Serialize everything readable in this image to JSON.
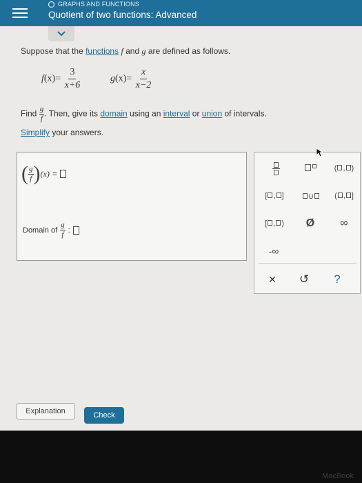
{
  "header": {
    "topic": "GRAPHS AND FUNCTIONS",
    "title": "Quotient of two functions: Advanced"
  },
  "prompt": {
    "intro_pre": "Suppose that the ",
    "intro_link": "functions",
    "intro_f": "f",
    "intro_and": " and ",
    "intro_g": "g",
    "intro_post": " are defined as follows.",
    "f_name": "f",
    "f_arg": "(x)=",
    "f_num": "3",
    "f_den": "x+6",
    "g_name": "g",
    "g_arg": "(x)=",
    "g_num": "x",
    "g_den": "x−2",
    "find_label": "Find",
    "find_num": "g",
    "find_den": "f",
    "find_then": ". Then, give its ",
    "domain_link": "domain",
    "using": " using an ",
    "interval_link": "interval",
    "or": " or ",
    "union_link": "union",
    "of_intervals": " of intervals.",
    "simplify_link": "Simplify",
    "simplify_rest": " your answers."
  },
  "answer": {
    "frac_num": "g",
    "frac_den": "f",
    "arg": "(x)",
    "equals": "=",
    "domain_label": "Domain of",
    "domain_num": "g",
    "domain_den": "f",
    "colon": ":"
  },
  "keypad": {
    "union": "∪",
    "empty_set": "Ø",
    "infinity": "∞",
    "neg_infinity": "-∞",
    "clear": "×",
    "undo": "↺",
    "help": "?"
  },
  "buttons": {
    "explanation": "Explanation",
    "check": "Check"
  },
  "brand": "MacBook",
  "colors": {
    "header": "#1f6f9b",
    "link": "#1f6f9b",
    "check_button": "#1f6f9b",
    "background": "#ebeae7"
  }
}
